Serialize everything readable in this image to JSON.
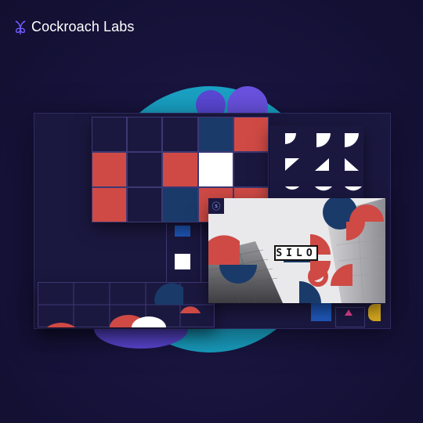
{
  "brand": {
    "name": "Cockroach Labs",
    "logo_icon": "cockroach-labs-logo-icon"
  },
  "artwork": {
    "card_title": "SILO",
    "colors": {
      "background": "#16123a",
      "navy": "#1b1840",
      "blue": "#1a3a6a",
      "red": "#cf4a45",
      "white": "#ffffff",
      "teal": "#1aa2c5",
      "purple": "#5b48d6"
    }
  }
}
